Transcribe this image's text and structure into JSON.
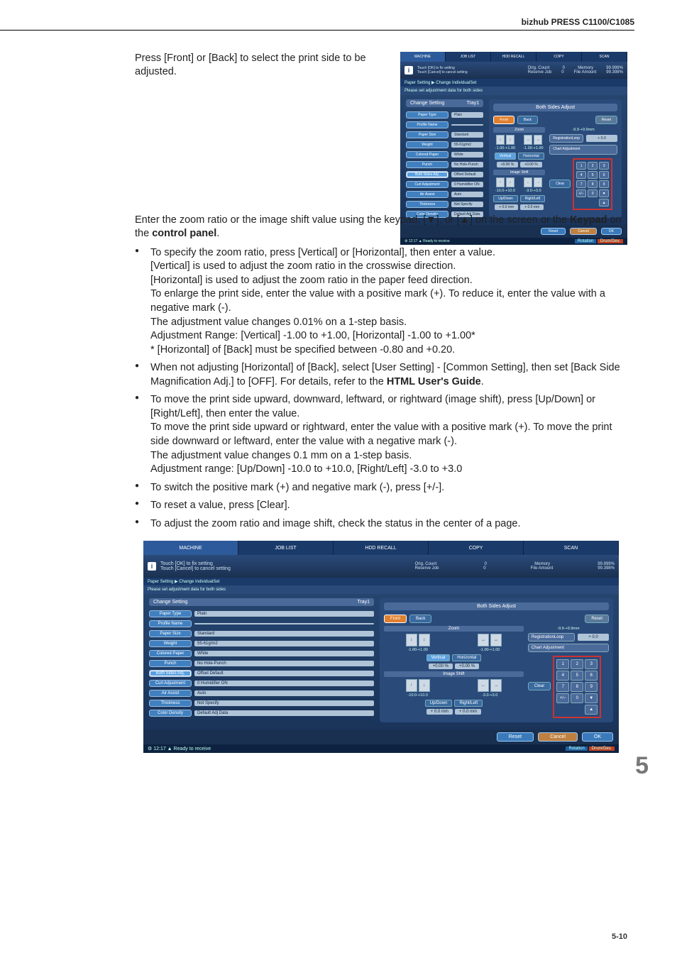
{
  "header": {
    "title": "bizhub PRESS C1100/C1085"
  },
  "intro1": "Press [Front] or [Back] to select the print side to be adjusted.",
  "intro2_a": "Enter the zoom ratio or the image shift value using the keypad, [▼], or [▲] on the screen or the ",
  "intro2_b": "Keypad",
  "intro2_c": " on the ",
  "intro2_d": "control panel",
  "intro2_e": ".",
  "bullets": {
    "b1": "To specify the zoom ratio, press [Vertical] or [Horizontal], then enter a value.\n[Vertical] is used to adjust the zoom ratio in the crosswise direction.\n[Horizontal] is used to adjust the zoom ratio in the paper feed direction.\nTo enlarge the print side, enter the value with a positive mark (+). To reduce it, enter the value with a negative mark (-).\nThe adjustment value changes 0.01% on a 1-step basis.\nAdjustment Range: [Vertical] -1.00 to +1.00, [Horizontal] -1.00 to +1.00*\n* [Horizontal] of [Back] must be specified between -0.80 and +0.20.",
    "b2_a": "When not adjusting [Horizontal] of [Back], select [User Setting] - [Common Setting], then set [Back Side Magnification Adj.] to [OFF]. For details, refer to the ",
    "b2_b": "HTML User's Guide",
    "b2_c": ".",
    "b3": "To move the print side upward, downward, leftward, or rightward (image shift), press [Up/Down] or [Right/Left], then enter the value.\nTo move the print side upward or rightward, enter the value with a positive mark (+). To move the print side downward or leftward, enter the value with a negative mark (-).\nThe adjustment value changes 0.1 mm on a 1-step basis.\nAdjustment range: [Up/Down] -10.0 to +10.0, [Right/Left] -3.0 to +3.0",
    "b4": "To switch the positive mark (+) and negative mark (-), press [+/-].",
    "b5": "To reset a value, press [Clear].",
    "b6": "To adjust the zoom ratio and image shift, check the status in the center of a page."
  },
  "page_big": "5",
  "page_small": "5-10",
  "shot": {
    "tabs": [
      "MACHINE",
      "JOB LIST",
      "HDD RECALL",
      "COPY",
      "SCAN"
    ],
    "info_lines": [
      "Touch [OK] to fix setting",
      "Touch [Cancel] to cancel setting"
    ],
    "stats": {
      "r1": {
        "l": "Orig. Count",
        "m": "0",
        "r": "Memory",
        "v": "99.999%"
      },
      "r2": {
        "l": "Reserve Job",
        "m": "0",
        "r": "File Amount",
        "v": "99.398%"
      }
    },
    "bread_a": "Paper Setting",
    "bread_b": "Change IndividualSet",
    "sub": "Please set adjustment data for both sides",
    "left_title_a": "Change Setting",
    "left_title_b": "Tray1",
    "rows": [
      {
        "k": "Paper Type",
        "v": "Plain"
      },
      {
        "k": "Profile Name",
        "v": ""
      },
      {
        "k": "Paper Size",
        "v": "Standard"
      },
      {
        "k": "Weight",
        "v": "55-61g/m2"
      },
      {
        "k": "Colored Paper",
        "v": "White"
      },
      {
        "k": "Punch",
        "v": "No Hole-Punch"
      },
      {
        "k": "Both Sides Adj.",
        "v": "Offset Default"
      },
      {
        "k": "Curl Adjustment",
        "v": "0  Humidifier ON"
      },
      {
        "k": "Air Assist",
        "v": "Auto"
      },
      {
        "k": "Thickness",
        "v": "Not Specify"
      },
      {
        "k": "Color Density",
        "v": "Default Adj Data"
      }
    ],
    "right_title": "Both Sides Adjust",
    "front": "Front",
    "back": "Back",
    "reset": "Reset",
    "zoom": "Zoom",
    "zoom_r1": "-1.00-+1.00",
    "zoom_r2": "-1.00-+1.00",
    "vertical": "Vertical",
    "horizontal": "Horizontal",
    "zv1": "+0.00 %",
    "zv2": "+0.00 %",
    "image_shift": "Image Shift",
    "is_r1": "-10.0-+10.0",
    "is_r2": "-3.0-+3.0",
    "updown": "Up/Down",
    "rightleft": "Right/Left",
    "isv1": "+ 0.0 mm",
    "isv2": "+ 0.0 mm",
    "reg_range": "-9.9-+9.9mm",
    "reg_btn": "RegistrationLoop",
    "reg_val": "+ 0.0",
    "chart": "Chart Adjustment",
    "clear": "Clear",
    "keys": [
      "1",
      "2",
      "3",
      "4",
      "5",
      "6",
      "7",
      "8",
      "9",
      "+/−",
      "0",
      "▼",
      "▲"
    ],
    "foot": {
      "reset": "Reset",
      "cancel": "Cancel",
      "ok": "OK"
    },
    "status_time": "12:17",
    "status_msg": "Ready to receive",
    "rotation": "Rotation",
    "drum": "Drum/Dev."
  }
}
